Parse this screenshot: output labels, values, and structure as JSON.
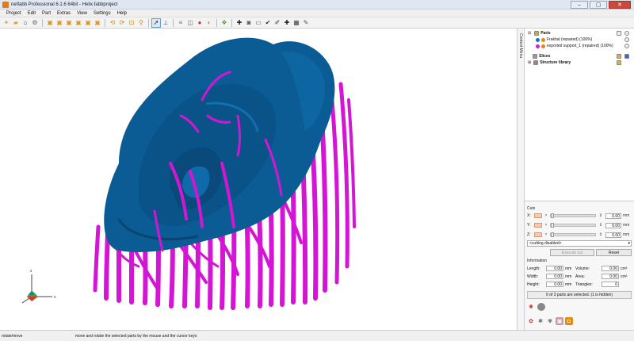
{
  "window": {
    "title": "netfabb Professional 6.1.6 64bit - Helix.fabbproject",
    "controls": [
      "–",
      "▢",
      "✕"
    ]
  },
  "menu": [
    "Project",
    "Edit",
    "Part",
    "Extras",
    "View",
    "Settings",
    "Help"
  ],
  "toolbar": {
    "icons": [
      "new-icon",
      "open-icon",
      "save-icon",
      "settings-icon",
      "sep",
      "view-front-icon",
      "view-back-icon",
      "view-left-icon",
      "view-right-icon",
      "view-top-icon",
      "view-bottom-icon",
      "sep",
      "rotate-ccw-icon",
      "rotate-cw-icon",
      "zoom-fit-icon",
      "zoom-icon",
      "sep",
      "select-cursor-icon",
      "measure-icon",
      "sep",
      "slice-icon",
      "mesh-icon",
      "support-icon",
      "color-icon",
      "sep",
      "part-icon",
      "sep",
      "add-icon",
      "camera-icon",
      "ruler-icon",
      "check-icon",
      "wand-icon",
      "repair-icon",
      "fabb-icon",
      "brush-icon"
    ]
  },
  "side_tab": {
    "label": "Context Menu"
  },
  "tree": {
    "parts_label": "Parts",
    "parts": [
      {
        "label": "Frakhal (repaired) (100%)",
        "color": "#1e6fc7"
      },
      {
        "label": "exported support_1 (repaired) (100%)",
        "color": "#cc22cc"
      }
    ],
    "slices_label": "Slices",
    "structure_label": "Structure library"
  },
  "cuts": {
    "label": "Cuts",
    "axes": [
      {
        "axis": "X:",
        "value": "0.00",
        "unit": "mm"
      },
      {
        "axis": "Y:",
        "value": "0.00",
        "unit": "mm"
      },
      {
        "axis": "Z:",
        "value": "0.00",
        "unit": "mm"
      }
    ],
    "select": "<cutting disabled>",
    "execute_label": "Execute cut",
    "reset_label": "Reset"
  },
  "info": {
    "label": "Information",
    "length": {
      "label": "Length:",
      "value": "0.00",
      "unit": "mm"
    },
    "width": {
      "label": "Width:",
      "value": "0.00",
      "unit": "mm"
    },
    "height": {
      "label": "Height:",
      "value": "0.00",
      "unit": "mm"
    },
    "volume": {
      "label": "Volume:",
      "value": "0.00",
      "unit": "cm³"
    },
    "area": {
      "label": "Area:",
      "value": "0.00",
      "unit": "cm²"
    },
    "triangles": {
      "label": "Triangles:",
      "value": "0"
    }
  },
  "selection_status": "0 of 3 parts are selected. (1 is hidden)",
  "status": {
    "mode": "rotate/move",
    "hint": "move and rotate the selected parts by the mouse and the cursor keys"
  },
  "axes_labels": {
    "x": "x",
    "z": "z"
  },
  "colors": {
    "model": "#0b5b94",
    "support": "#d316d3",
    "window_bg": "#dfe8f2"
  }
}
